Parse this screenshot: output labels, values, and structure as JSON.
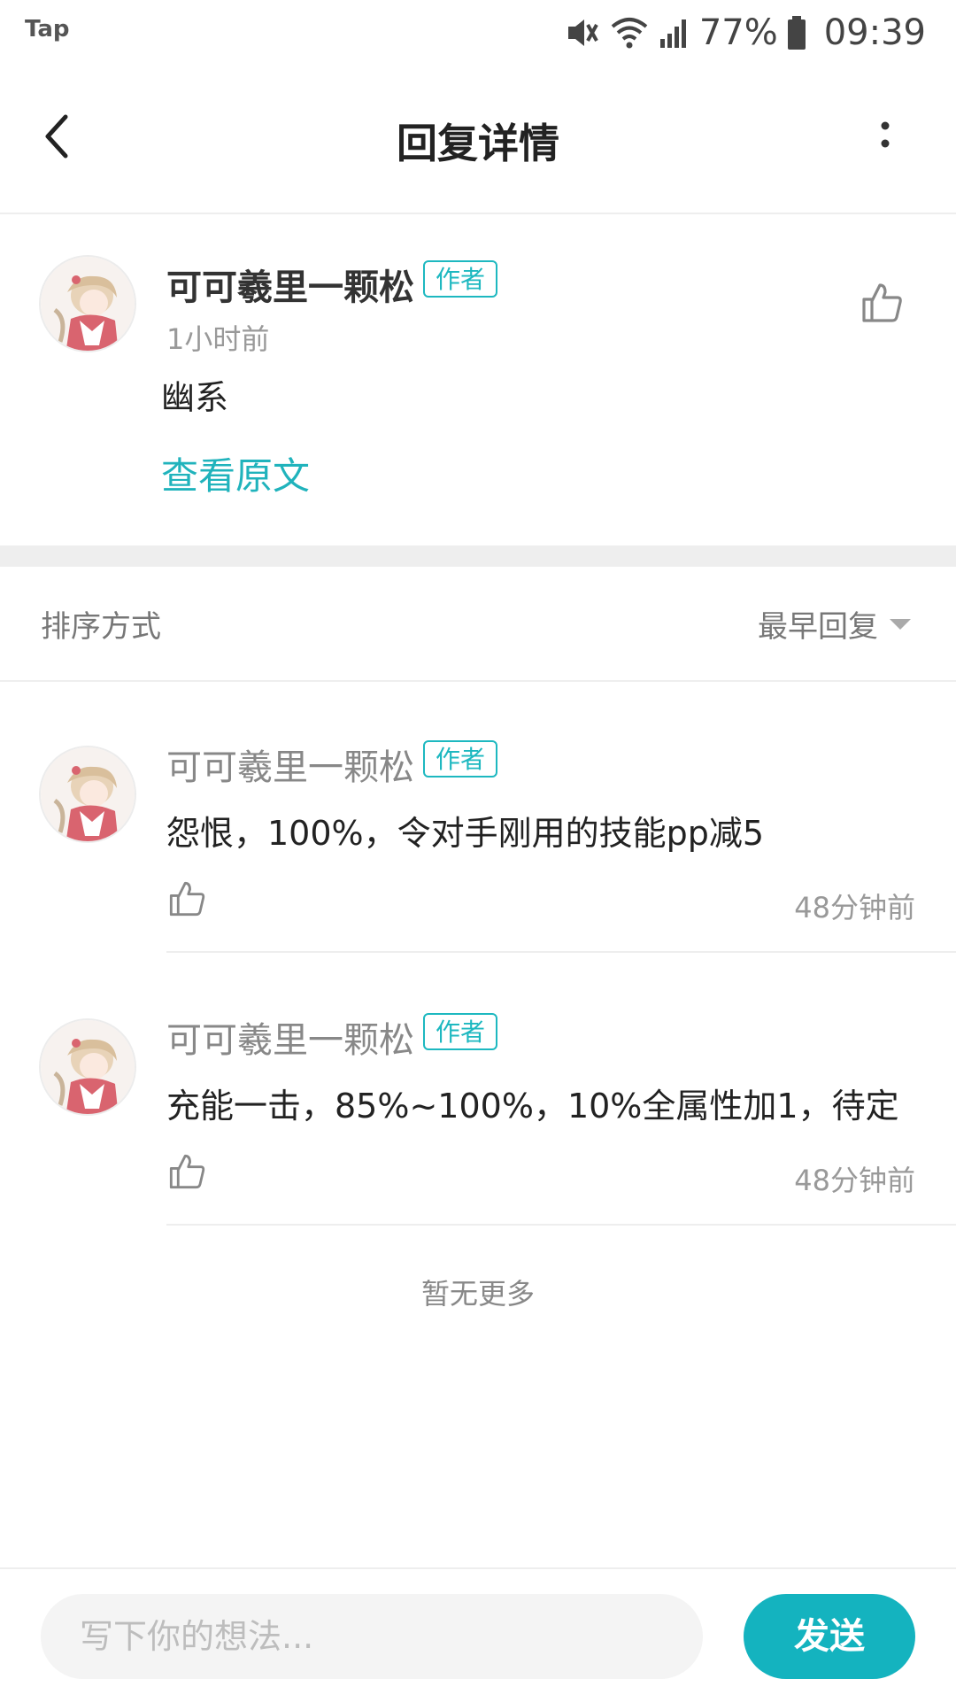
{
  "status_bar": {
    "app_label": "Tap",
    "battery": "77%",
    "time": "09:39"
  },
  "header": {
    "title": "回复详情"
  },
  "original_post": {
    "author": "可可羲里一颗松",
    "badge": "作者",
    "time": "1小时前",
    "content": "幽系",
    "view_original": "查看原文"
  },
  "sort": {
    "label": "排序方式",
    "value": "最早回复"
  },
  "replies": [
    {
      "author": "可可羲里一颗松",
      "badge": "作者",
      "text": "怨恨，100%，令对手刚用的技能pp减5",
      "time": "48分钟前"
    },
    {
      "author": "可可羲里一颗松",
      "badge": "作者",
      "text": "充能一击，85%~100%，10%全属性加1，待定",
      "time": "48分钟前"
    }
  ],
  "no_more": "暂无更多",
  "bottom_bar": {
    "input_placeholder": "写下你的想法...",
    "send_label": "发送"
  },
  "colors": {
    "accent": "#14b3bf",
    "link": "#20b3bc",
    "divider": "#eeeeee"
  }
}
